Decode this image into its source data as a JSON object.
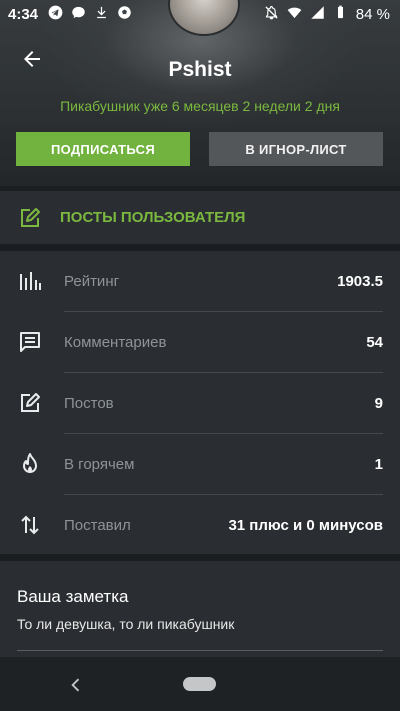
{
  "status_bar": {
    "time": "4:34",
    "battery": "84 %",
    "left_icons": [
      "telegram-icon",
      "chat-icon",
      "download-icon",
      "soccer-ball-icon"
    ],
    "right_icons": [
      "notifications-off-icon",
      "wifi-icon",
      "signal-icon",
      "battery-icon"
    ]
  },
  "profile": {
    "username": "Pshist",
    "tenure": "Пикабушник уже 6 месяцев 2 недели 2 дня"
  },
  "actions": {
    "subscribe": "ПОДПИСАТЬСЯ",
    "ignore": "В ИГНОР-ЛИСТ"
  },
  "posts_link": {
    "label": "ПОСТЫ ПОЛЬЗОВАТЕЛЯ",
    "icon": "edit-icon"
  },
  "stats": [
    {
      "icon": "bar-chart-icon",
      "label": "Рейтинг",
      "value": "1903.5"
    },
    {
      "icon": "comment-icon",
      "label": "Комментариев",
      "value": "54"
    },
    {
      "icon": "edit-icon",
      "label": "Постов",
      "value": "9"
    },
    {
      "icon": "fire-icon",
      "label": "В горячем",
      "value": "1"
    },
    {
      "icon": "swap-vertical-icon",
      "label": "Поставил",
      "value": "31 плюс и 0 минусов"
    }
  ],
  "note": {
    "title": "Ваша заметка",
    "text": "То ли девушка, то ли пикабушник"
  },
  "colors": {
    "accent_green": "#72b23f",
    "background": "#1b1e20",
    "card": "#2a2e32",
    "muted_text": "#8e9397"
  }
}
